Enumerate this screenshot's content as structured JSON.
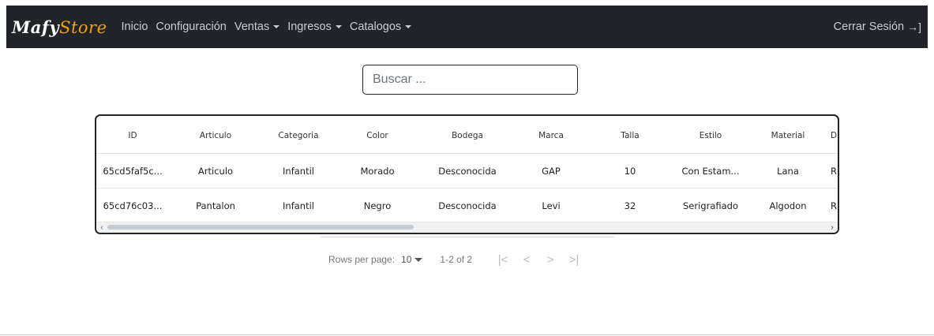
{
  "nav": {
    "brand_part1": "Mafy",
    "brand_part2": "Store",
    "links": [
      {
        "label": "Inicio"
      },
      {
        "label": "Configuración"
      },
      {
        "label": "Ventas"
      },
      {
        "label": "Ingresos"
      },
      {
        "label": "Catalogos"
      }
    ],
    "logout_label": "Cerrar Sesión",
    "logout_icon": "sign-out-icon"
  },
  "search": {
    "placeholder": "Buscar ..."
  },
  "table": {
    "columns": [
      "ID",
      "Articulo",
      "Categoria",
      "Color",
      "Bodega",
      "Marca",
      "Talla",
      "Estilo",
      "Material",
      "Di"
    ],
    "rows": [
      [
        "65cd5faf5c...",
        "Articulo",
        "Infantil",
        "Morado",
        "Desconocida",
        "GAP",
        "10",
        "Con Estam...",
        "Lana",
        "R"
      ],
      [
        "65cd76c03...",
        "Pantalon",
        "Infantil",
        "Negro",
        "Desconocida",
        "Levi",
        "32",
        "Serigrafiado",
        "Algodon",
        "R"
      ]
    ]
  },
  "pagination": {
    "rows_per_page_label": "Rows per page:",
    "rows_per_page_value": "10",
    "range_text": "1-2 of 2",
    "first_icon": "|<",
    "prev_icon": "<",
    "next_icon": ">",
    "last_icon": ">|"
  },
  "colors": {
    "navbar_bg": "#212529",
    "brand_accent": "#f0a500"
  }
}
